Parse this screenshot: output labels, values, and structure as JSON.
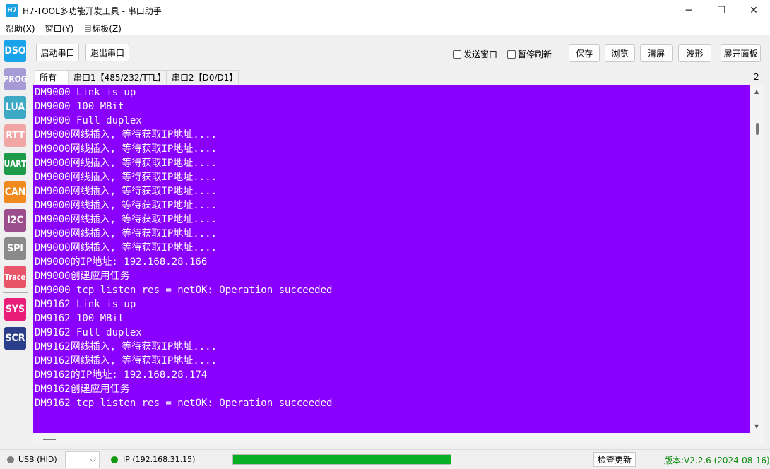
{
  "window": {
    "icon_text": "H7",
    "title": "H7-TOOL多功能开发工具 - 串口助手",
    "minimize": "─",
    "maximize": "☐",
    "close": "✕"
  },
  "menu": [
    "帮助(X)",
    "窗口(Y)",
    "目标板(Z)"
  ],
  "sidebar": [
    {
      "label": "DSO",
      "color": "#1aa3e8"
    },
    {
      "label": "PROG",
      "color": "#a79bd6"
    },
    {
      "label": "LUA",
      "color": "#3ea9c5"
    },
    {
      "label": "RTT",
      "color": "#f1a6a6"
    },
    {
      "label": "UART",
      "color": "#1f9a4a"
    },
    {
      "label": "CAN",
      "color": "#f08a1e"
    },
    {
      "label": "I2C",
      "color": "#9c4d8c"
    },
    {
      "label": "SPI",
      "color": "#8a8a8a"
    },
    {
      "label": "Trace",
      "color": "#e9566a"
    },
    {
      "label": "SYS",
      "color": "#e91e78"
    },
    {
      "label": "SCR",
      "color": "#2b3e8a"
    }
  ],
  "toolbar": {
    "start_port": "启动串口",
    "exit_port": "退出串口",
    "send_window": "发送窗口",
    "pause_refresh": "暂停刷新",
    "save": "保存",
    "browse": "浏览",
    "clear": "清屏",
    "waveform": "波形",
    "expand_panel": "展开面板"
  },
  "tabs": [
    "所有",
    "串口1【485/232/TTL】",
    "串口2【D0/D1】"
  ],
  "tab_count": "2",
  "terminal": {
    "bg_color": "#8a00ff",
    "lines": [
      "DM9000 Link is up",
      "DM9000 100 MBit",
      "DM9000 Full duplex",
      "DM9000网线插入, 等待获取IP地址....",
      "DM9000网线插入, 等待获取IP地址....",
      "DM9000网线插入, 等待获取IP地址....",
      "DM9000网线插入, 等待获取IP地址....",
      "DM9000网线插入, 等待获取IP地址....",
      "DM9000网线插入, 等待获取IP地址....",
      "DM9000网线插入, 等待获取IP地址....",
      "DM9000网线插入, 等待获取IP地址....",
      "DM9000网线插入, 等待获取IP地址....",
      "DM9000的IP地址: 192.168.28.166",
      "DM9000创建应用任务",
      "DM9000 tcp listen res = netOK: Operation succeeded",
      "DM9162 Link is up",
      "DM9162 100 MBit",
      "DM9162 Full duplex",
      "DM9162网线插入, 等待获取IP地址....",
      "DM9162网线插入, 等待获取IP地址....",
      "DM9162的IP地址: 192.168.28.174",
      "DM9162创建应用任务",
      "DM9162 tcp listen res = netOK: Operation succeeded"
    ]
  },
  "status": {
    "usb": "USB (HID)",
    "usb_dot_color": "#808080",
    "ip": "IP (192.168.31.15)",
    "ip_dot_color": "#109a10",
    "progress_fraction": 1.0,
    "check_update": "检查更新",
    "version": "版本:V2.2.6 (2024-08-16)"
  }
}
